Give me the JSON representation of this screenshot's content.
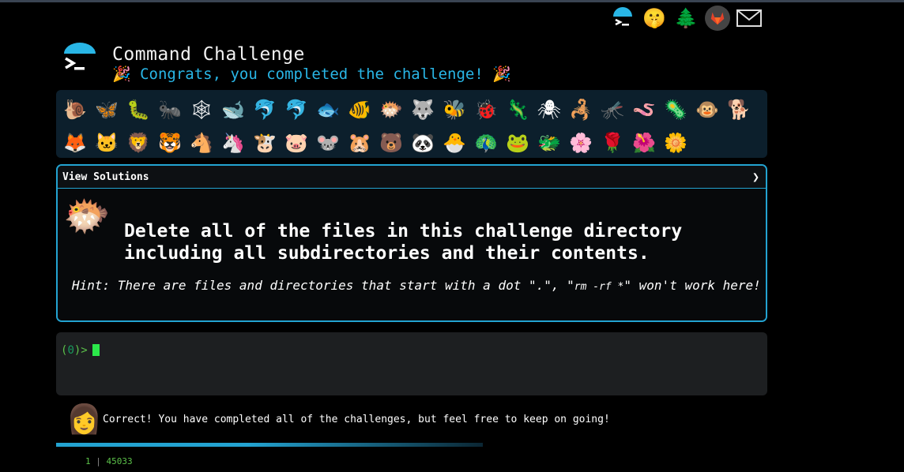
{
  "header": {
    "title": "Command Challenge",
    "subtitle": "🎉 Congrats, you completed the challenge! 🎉"
  },
  "top_icons": [
    {
      "name": "terminal-umbrella-icon",
      "glyph": "☂"
    },
    {
      "name": "shushing-face-icon",
      "glyph": "🤫"
    },
    {
      "name": "tree-icon",
      "glyph": "🌲"
    },
    {
      "name": "gitlab-icon",
      "glyph": "🦊"
    },
    {
      "name": "mail-icon",
      "glyph": "✉"
    }
  ],
  "animals": [
    "🐌",
    "🦋",
    "🐛",
    "🐜",
    "🕸",
    "🐋",
    "🐬",
    "🐬",
    "🐟",
    "🐠",
    "🐡",
    "🐺",
    "🐝",
    "🐞",
    "🦎",
    "🕷",
    "🦂",
    "🦟",
    "🪱",
    "🦠",
    "🐵",
    "🐕",
    "🦊",
    "🐱",
    "🦁",
    "🐯",
    "🐴",
    "🦄",
    "🐮",
    "🐷",
    "🐭",
    "🐹",
    "🐻",
    "🐼",
    "🐣",
    "🦚",
    "🐸",
    "🐲",
    "🌸",
    "🌹",
    "🌺",
    "🌼"
  ],
  "solutions": {
    "header_label": "View Solutions",
    "chevron": "❯",
    "challenge_icon": "🐡",
    "challenge_text": "Delete all of the files in this challenge directory including all subdirectories and their contents.",
    "hint_prefix": "Hint: There are files and directories that start with a dot \".\", \"",
    "hint_code": "rm -rf *",
    "hint_suffix": "\" won't work here!"
  },
  "terminal": {
    "prompt_open": "(",
    "prompt_num": "0",
    "prompt_close": ")>"
  },
  "message": {
    "icon": "👩",
    "text": "Correct! You have completed all of the challenges, but feel free to keep on going!"
  },
  "progress": 0.45,
  "footer": {
    "count": "1",
    "sep": "|",
    "value": "45033"
  }
}
